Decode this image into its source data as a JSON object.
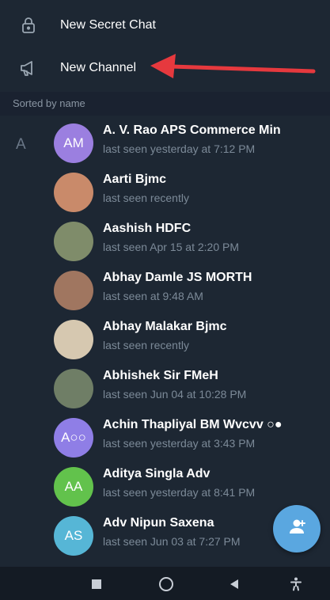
{
  "menu": {
    "secret_chat_label": "New Secret Chat",
    "channel_label": "New Channel"
  },
  "sorted_label": "Sorted by name",
  "section_letter": "A",
  "contacts": [
    {
      "name": "A. V. Rao APS Commerce Min",
      "status": "last seen yesterday at 7:12 PM",
      "initials": "AM",
      "color": "#9b7fe0"
    },
    {
      "name": "Aarti Bjmc",
      "status": "last seen recently",
      "initials": "",
      "color": "#c98a6a"
    },
    {
      "name": "Aashish HDFC",
      "status": "last seen Apr 15 at 2:20 PM",
      "initials": "",
      "color": "#7f8c6a"
    },
    {
      "name": "Abhay Damle JS MORTH",
      "status": "last seen at 9:48 AM",
      "initials": "",
      "color": "#a07660"
    },
    {
      "name": "Abhay Malakar Bjmc",
      "status": "last seen recently",
      "initials": "",
      "color": "#d6c8b0"
    },
    {
      "name": "Abhishek Sir FMeH",
      "status": "last seen Jun 04 at 10:28 PM",
      "initials": "",
      "color": "#6f7e66"
    },
    {
      "name": "Achin Thapliyal BM Wvcvv ○●",
      "status": "last seen yesterday at 3:43 PM",
      "initials": "A○○",
      "color": "#8f7ee6"
    },
    {
      "name": "Aditya Singla Adv",
      "status": "last seen yesterday at 8:41 PM",
      "initials": "AA",
      "color": "#62c24c"
    },
    {
      "name": "Adv Nipun Saxena",
      "status": "last seen Jun 03 at 7:27 PM",
      "initials": "AS",
      "color": "#56b6d6"
    }
  ],
  "colors": {
    "background": "#1d2733",
    "accent": "#5aa7e0",
    "arrow": "#e6393e"
  }
}
